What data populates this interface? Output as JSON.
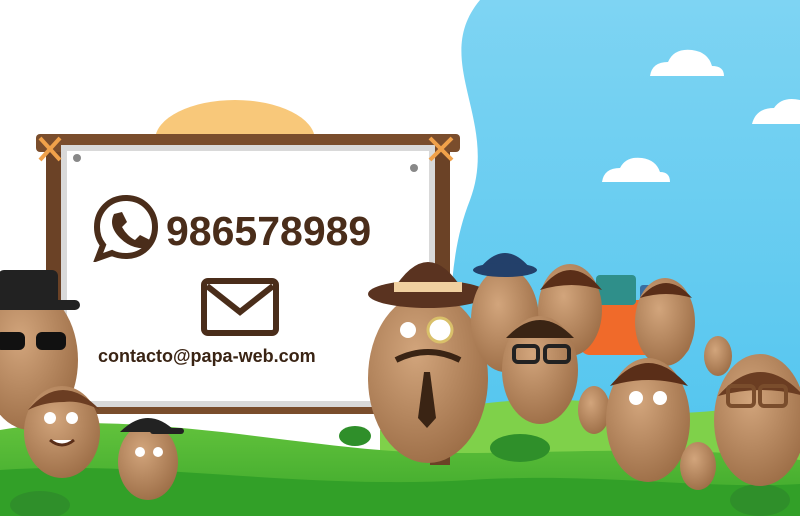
{
  "banner": {
    "phone_number": "986578989",
    "email": "contacto@papa-web.com"
  },
  "icons": {
    "phone": "whatsapp-icon",
    "email": "envelope-icon"
  },
  "colors": {
    "sky": "#5bc8f0",
    "grass": "#5fc03a",
    "wood": "#6b4226",
    "text": "#4a2d1a",
    "potato": "#b88a63"
  }
}
